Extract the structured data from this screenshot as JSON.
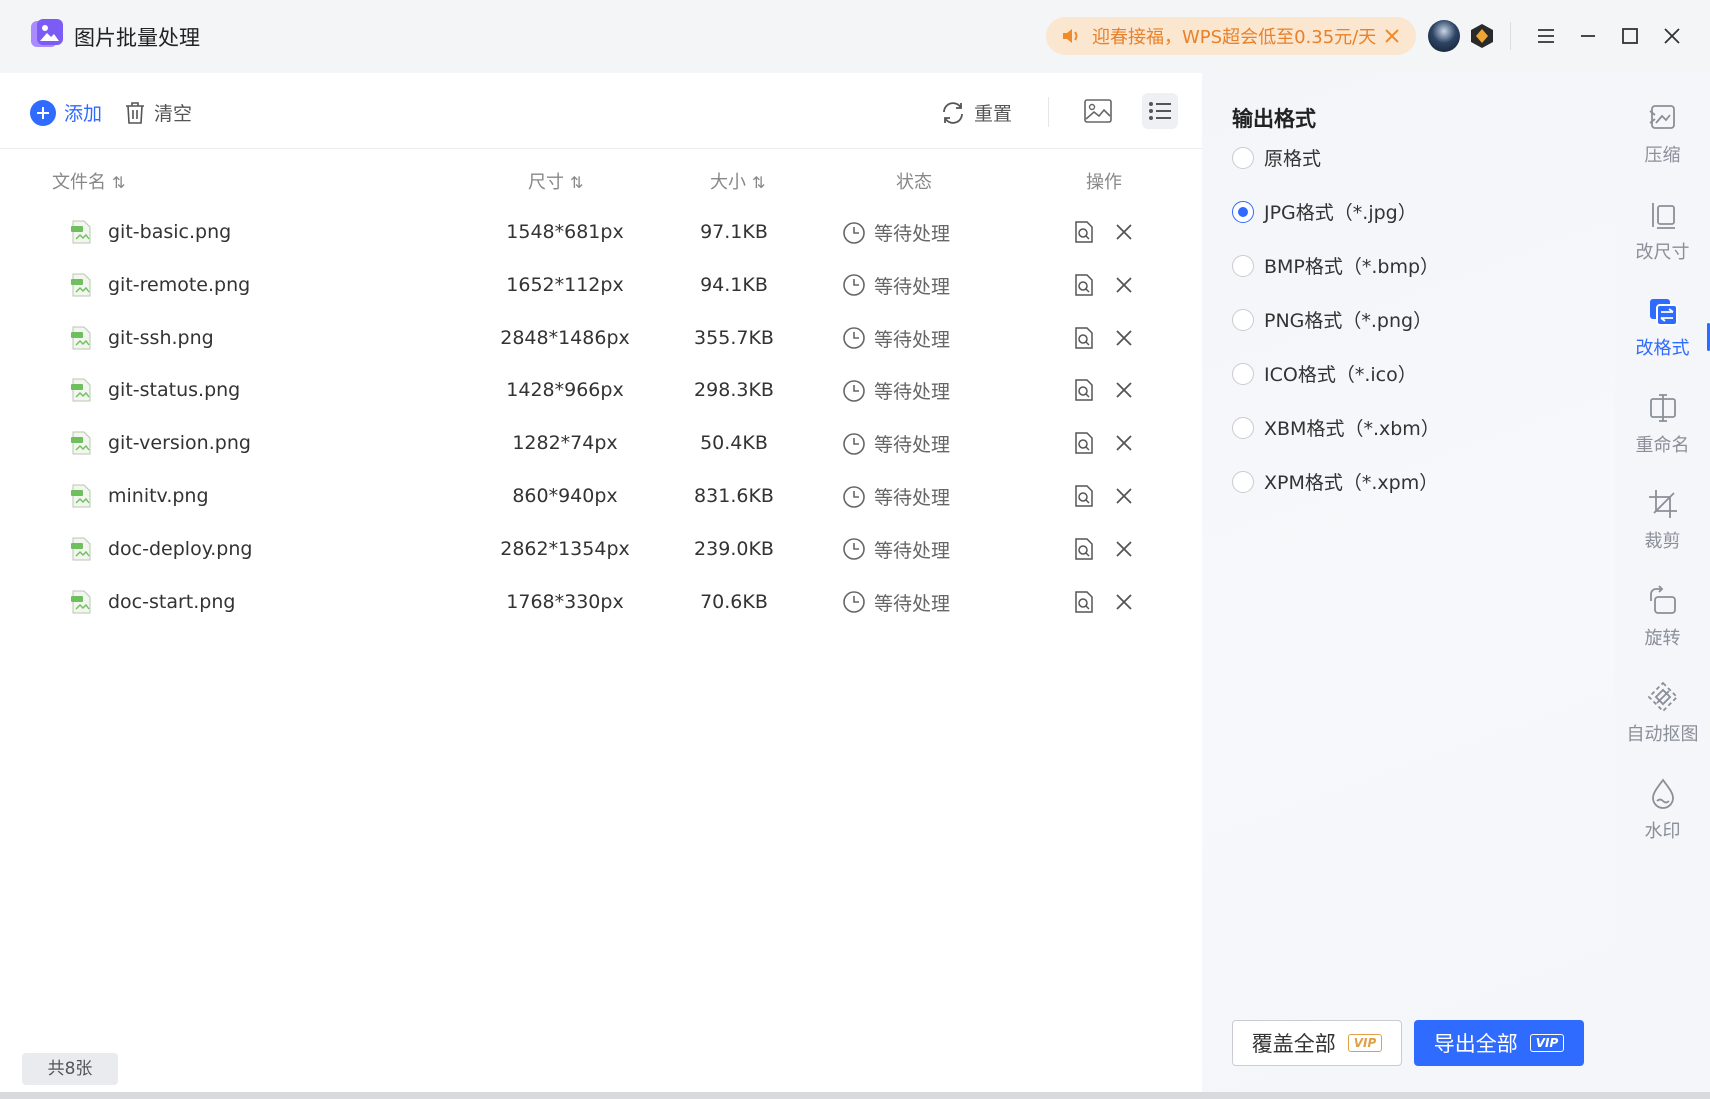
{
  "app": {
    "title": "图片批量处理"
  },
  "promo": {
    "text": "迎春接福，WPS超会低至0.35元/天"
  },
  "toolbar": {
    "add_label": "添加",
    "clear_label": "清空",
    "reset_label": "重置"
  },
  "table": {
    "headers": {
      "name": "文件名",
      "size": "尺寸",
      "filesize": "大小",
      "status": "状态",
      "actions": "操作"
    },
    "sort_glyph": "⇅",
    "rows": [
      {
        "name": "git-basic.png",
        "dimensions": "1548*681px",
        "filesize": "97.1KB",
        "status": "等待处理"
      },
      {
        "name": "git-remote.png",
        "dimensions": "1652*112px",
        "filesize": "94.1KB",
        "status": "等待处理"
      },
      {
        "name": "git-ssh.png",
        "dimensions": "2848*1486px",
        "filesize": "355.7KB",
        "status": "等待处理"
      },
      {
        "name": "git-status.png",
        "dimensions": "1428*966px",
        "filesize": "298.3KB",
        "status": "等待处理"
      },
      {
        "name": "git-version.png",
        "dimensions": "1282*74px",
        "filesize": "50.4KB",
        "status": "等待处理"
      },
      {
        "name": "minitv.png",
        "dimensions": "860*940px",
        "filesize": "831.6KB",
        "status": "等待处理"
      },
      {
        "name": "doc-deploy.png",
        "dimensions": "2862*1354px",
        "filesize": "239.0KB",
        "status": "等待处理"
      },
      {
        "name": "doc-start.png",
        "dimensions": "1768*330px",
        "filesize": "70.6KB",
        "status": "等待处理"
      }
    ]
  },
  "footer": {
    "count_label": "共8张"
  },
  "settings": {
    "title": "输出格式",
    "selected_index": 1,
    "formats": [
      {
        "label": "原格式"
      },
      {
        "label": "JPG格式（*.jpg）"
      },
      {
        "label": "BMP格式（*.bmp）"
      },
      {
        "label": "PNG格式（*.png）"
      },
      {
        "label": "ICO格式（*.ico）"
      },
      {
        "label": "XBM格式（*.xbm）"
      },
      {
        "label": "XPM格式（*.xpm）"
      }
    ],
    "cover_all_label": "覆盖全部",
    "export_all_label": "导出全部",
    "vip_label": "VIP"
  },
  "sidenav": {
    "active_index": 2,
    "items": [
      {
        "label": "压缩",
        "icon": "compress-icon"
      },
      {
        "label": "改尺寸",
        "icon": "resize-icon"
      },
      {
        "label": "改格式",
        "icon": "convert-format-icon"
      },
      {
        "label": "重命名",
        "icon": "rename-icon"
      },
      {
        "label": "裁剪",
        "icon": "crop-icon"
      },
      {
        "label": "旋转",
        "icon": "rotate-icon"
      },
      {
        "label": "自动抠图",
        "icon": "auto-cutout-icon"
      },
      {
        "label": "水印",
        "icon": "watermark-icon"
      }
    ]
  },
  "colors": {
    "accent": "#2f6bff",
    "promo_text": "#e8812a",
    "promo_bg": "#fbe6cf"
  }
}
